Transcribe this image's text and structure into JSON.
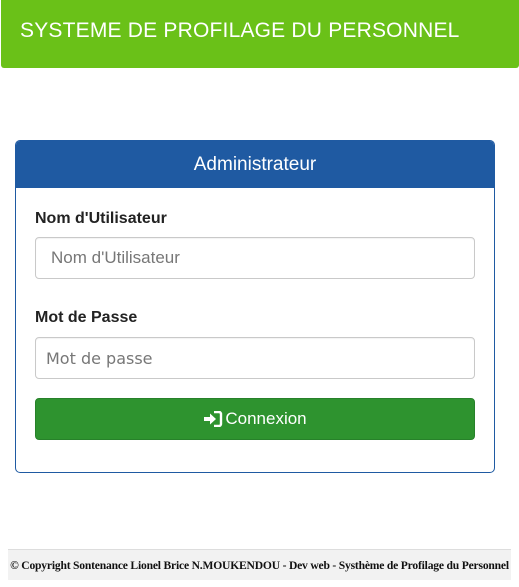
{
  "header": {
    "title": "SYSTEME DE PROFILAGE DU PERSONNEL",
    "color": "#6ac118"
  },
  "login_panel": {
    "heading": "Administrateur",
    "heading_color": "#1f5aa2",
    "username": {
      "label": "Nom d'Utilisateur",
      "placeholder": "Nom d'Utilisateur",
      "value": ""
    },
    "password": {
      "label": "Mot de Passe",
      "placeholder": "Mot de passe",
      "value": ""
    },
    "submit": {
      "label": "Connexion",
      "icon": "sign-in-icon",
      "color": "#2e932f"
    }
  },
  "footer": {
    "text": "© Copyright Sontenance Lionel Brice N.MOUKENDOU - Dev web - Systhème de Profilage du Personnel"
  }
}
